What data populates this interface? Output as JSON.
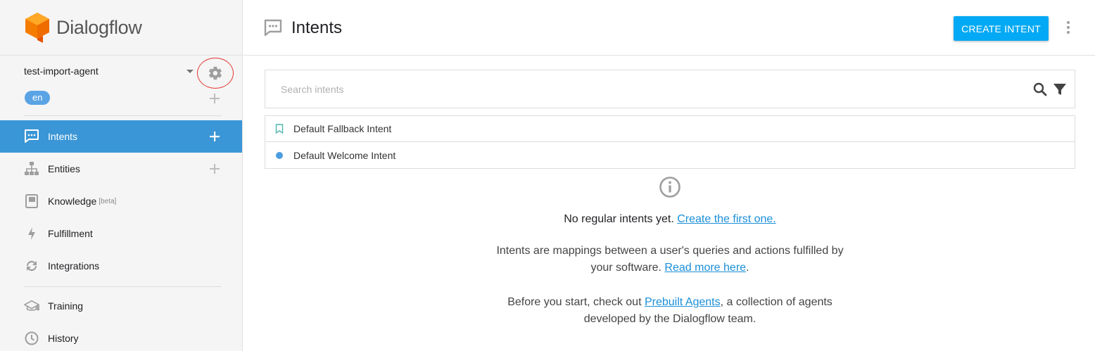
{
  "app": {
    "name": "Dialogflow"
  },
  "sidebar": {
    "agent_name": "test-import-agent",
    "language": "en",
    "nav": [
      {
        "label": "Intents",
        "icon": "chat-icon",
        "active": true
      },
      {
        "label": "Entities",
        "icon": "hierarchy-icon"
      },
      {
        "label": "Knowledge",
        "badge": "[beta]",
        "icon": "book-icon"
      },
      {
        "label": "Fulfillment",
        "icon": "bolt-icon"
      },
      {
        "label": "Integrations",
        "icon": "sync-icon"
      }
    ],
    "nav2": [
      {
        "label": "Training",
        "icon": "graduation-cap-icon"
      },
      {
        "label": "History",
        "icon": "clock-icon"
      }
    ]
  },
  "header": {
    "title": "Intents",
    "create_button": "CREATE INTENT"
  },
  "search": {
    "placeholder": "Search intents"
  },
  "intents": [
    {
      "name": "Default Fallback Intent",
      "marker": "bookmark-icon"
    },
    {
      "name": "Default Welcome Intent",
      "marker": "dot"
    }
  ],
  "empty_state": {
    "title": "No regular intents yet.",
    "title_link": "Create the first one.",
    "p1_a": "Intents are mappings between a user's queries and actions fulfilled by",
    "p1_b": "your software.",
    "p1_link": "Read more here",
    "p1_end": ".",
    "p2_a": "Before you start, check out",
    "p2_link": "Prebuilt Agents",
    "p2_b": ", a collection of agents",
    "p2_c": "developed by the Dialogflow team."
  },
  "colors": {
    "accent": "#3a96d6",
    "button": "#03a9f4",
    "link": "#1a8fd8",
    "logo": "#ef6c00",
    "highlight_circle": "#e53935"
  }
}
